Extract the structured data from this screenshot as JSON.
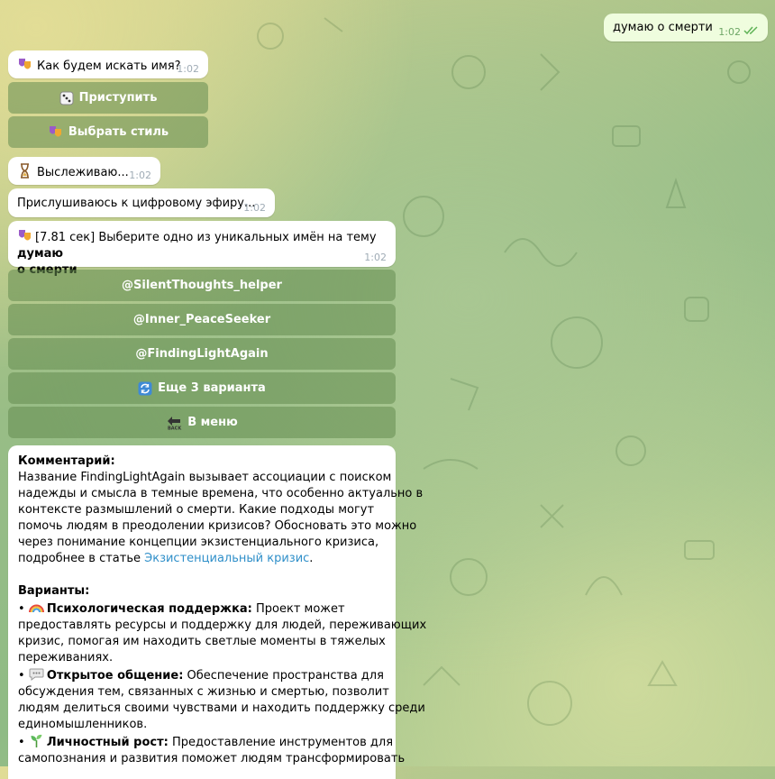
{
  "outgoing": {
    "text": "думаю о смерти",
    "time": "1:02"
  },
  "q1": {
    "text": "Как будем искать имя?",
    "time": "1:02",
    "icon": "theater-masks-icon"
  },
  "q1_buttons": [
    {
      "label": "Приступить",
      "icon": "dice-icon"
    },
    {
      "label": "Выбрать стиль",
      "icon": "theater-masks-icon"
    }
  ],
  "status1": {
    "text": "Выслеживаю...",
    "time": "1:02",
    "icon": "hourglass-icon"
  },
  "status2": {
    "text": "Прислушиваюсь к цифровому эфиру...",
    "time": "1:02"
  },
  "result": {
    "prefix": "[7.81 сек] Выберите одно из уникальных имён на тему ",
    "topic1": "думаю",
    "topic2": "о смерти",
    "time": "1:02",
    "icon": "theater-masks-icon"
  },
  "name_buttons": [
    {
      "label": "@SilentThoughts_helper"
    },
    {
      "label": "@Inner_PeaceSeeker"
    },
    {
      "label": "@FindingLightAgain"
    },
    {
      "label": "Еще 3 варианта",
      "icon": "refresh-icon"
    },
    {
      "label": "В меню",
      "icon": "back-arrow-icon"
    }
  ],
  "comment": {
    "heading": "Комментарий:",
    "lines": [
      "Название FindingLightAgain вызывает ассоциации с поиском",
      "надежды и смысла в темные времена, что особенно актуально в",
      "контексте размышлений о смерти. Какие подходы могут",
      "помочь людям в преодолении кризисов? Обосновать это можно",
      "через понимание концепции экзистенциального кризиса,"
    ],
    "last_prefix": "подробнее в статье ",
    "link": "Экзистенциальный кризис",
    "last_suffix": ".",
    "variants_heading": "Варианты:",
    "variants": [
      {
        "icon": "rainbow-icon",
        "title": "Психологическая поддержка:",
        "first": " Проект может",
        "rest": [
          "предоставлять ресурсы и поддержку для людей, переживающих",
          "кризис, помогая им находить светлые моменты в тяжелых",
          "переживаниях."
        ]
      },
      {
        "icon": "speech-bubble-icon",
        "title": "Открытое общение:",
        "first": " Обеспечение пространства для",
        "rest": [
          "обсуждения тем, связанных с жизнью и смертью, позволит",
          "людям делиться своими чувствами и находить поддержку среди",
          "единомышленников."
        ]
      },
      {
        "icon": "seedling-icon",
        "title": "Личностный рост:",
        "first": " Предоставление инструментов для",
        "rest": [
          "самопознания и развития поможет людям трансформировать"
        ]
      }
    ]
  },
  "colors": {
    "accent": "#2f8fc9",
    "outgoing_bubble": "#effdde",
    "keyboard_button": "#74985f"
  }
}
